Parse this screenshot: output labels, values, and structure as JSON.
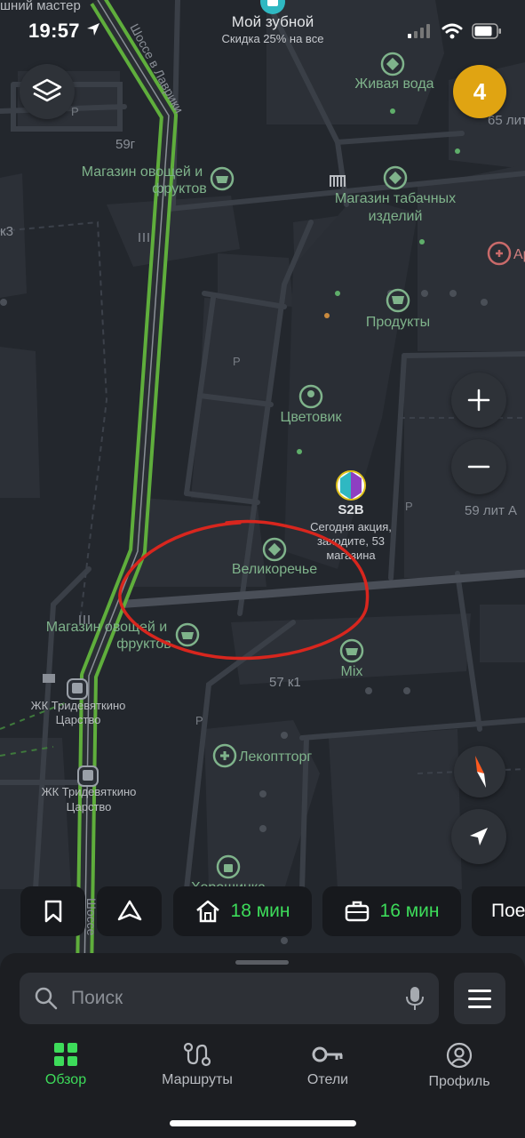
{
  "status_bar": {
    "time": "19:57"
  },
  "map": {
    "top_labels": {
      "left_cut": "шний мастер",
      "promo_title": "Мой зубной",
      "promo_sub": "Скидка 25% на все"
    },
    "road_labels": {
      "highway": "Шоссе в Лаврики",
      "highway_bottom": "Шоссе"
    },
    "pois": {
      "zhivaya_voda": "Живая вода",
      "veg_shop_top_1": "Магазин овощей и",
      "veg_shop_top_2": "фруктов",
      "tobacco_1": "Магазин табачных",
      "tobacco_2": "изделий",
      "apteka_cut": "Ар",
      "produkty": "Продукты",
      "tsvetovik": "Цветовик",
      "s2b": "S2B",
      "s2b_sub_1": "Сегодня акция,",
      "s2b_sub_2": "заходите, 53",
      "s2b_sub_3": "магазина",
      "velikorechye": "Великоречье",
      "veg_shop_bottom_1": "Магазин овощей и",
      "veg_shop_bottom_2": "фруктов",
      "mix": "Mix",
      "stop_1_line1": "ЖК Тридевяткино",
      "stop_1_line2": "Царство",
      "stop_2_line1": "ЖК Тридевяткино",
      "stop_2_line2": "Царство",
      "lekopttorg": "Лекоптторг",
      "bottom_cut": "Хорошинка"
    },
    "building_labels": {
      "b59g": "59г",
      "b65": "65 лит",
      "b59a": "59 лит А",
      "b57k1": "57 к1",
      "k3": "к3",
      "parking": "P"
    },
    "badge_count": "4"
  },
  "chips": {
    "home_time": "18 мин",
    "work_time": "16 мин",
    "more_cut": "Пое"
  },
  "search": {
    "placeholder": "Поиск"
  },
  "tabs": {
    "overview": "Обзор",
    "routes": "Маршруты",
    "hotels": "Отели",
    "profile": "Профиль"
  },
  "colors": {
    "accent_green": "#3ddc5a",
    "highway_green": "#5fae3c",
    "badge_yellow": "#e0a412",
    "annotation_red": "#d8261e",
    "poi_green": "#7fb38b",
    "map_background": "#22262c"
  }
}
